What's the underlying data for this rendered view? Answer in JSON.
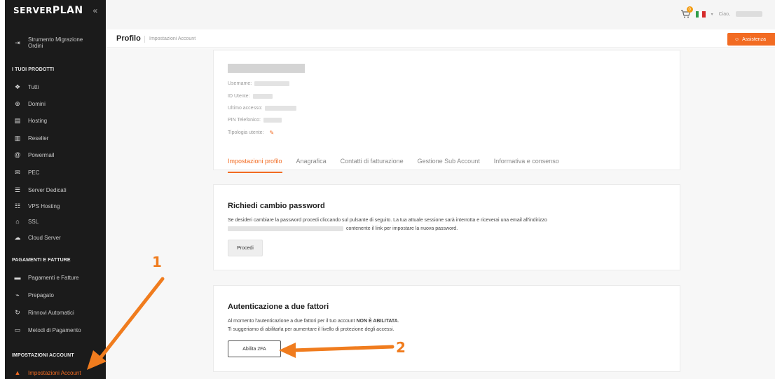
{
  "brand": {
    "name_prefix": "SERVER",
    "name_suffix": "PLAN",
    "collapse_icon": "double-chevron-left-icon"
  },
  "sidebar": {
    "migration": "Strumento Migrazione Ordini",
    "section_products": "I TUOI PRODOTTI",
    "products": [
      "Tutti",
      "Domini",
      "Hosting",
      "Reseller",
      "Powermail",
      "PEC",
      "Server Dedicati",
      "VPS Hosting",
      "SSL",
      "Cloud Server"
    ],
    "section_payments": "PAGAMENTI E FATTURE",
    "payments": [
      "Pagamenti e Fatture",
      "Prepagato",
      "Rinnovi Automatici",
      "Metodi di Pagamento"
    ],
    "section_account": "IMPOSTAZIONI ACCOUNT",
    "account_active": "Impostazioni Account"
  },
  "topbar": {
    "cart_count": "0",
    "greeting": "Ciao,"
  },
  "breadcrumb": {
    "title": "Profilo",
    "sub": "Impostazioni Account"
  },
  "assist_label": "Assistenza",
  "profile": {
    "username_label": "Username:",
    "id_label": "ID Utente:",
    "last_access_label": "Ultimo accesso:",
    "pin_label": "PIN Telefonico:",
    "type_label": "Tipologia utente:"
  },
  "tabs": [
    "Impostazioni profilo",
    "Anagrafica",
    "Contatti di fatturazione",
    "Gestione Sub Account",
    "Informativa e consenso"
  ],
  "password": {
    "title": "Richiedi cambio password",
    "text1": "Se desideri cambiare la password procedi cliccando sul pulsante di seguito. La tua attuale sessione sarà interrotta e riceverai una email all'indirizzo",
    "text2": "contenente il link per impostare la nuova password.",
    "button": "Procedi"
  },
  "tfa": {
    "title": "Autenticazione a due fattori",
    "text1_pre": "Al momento l'autenticazione a due fattori per il tuo account",
    "text1_bold": "NON È ABILITATA",
    "text1_post": ".",
    "text2": "Ti suggeriamo di abilitarla per aumentare il livello di protezione degli accessi.",
    "button": "Abilita 2FA"
  },
  "annotations": {
    "one": "1",
    "two": "2"
  },
  "colors": {
    "accent": "#f26b22",
    "sidebar_bg": "#1b1b1b",
    "annotation": "#f07c1e"
  }
}
